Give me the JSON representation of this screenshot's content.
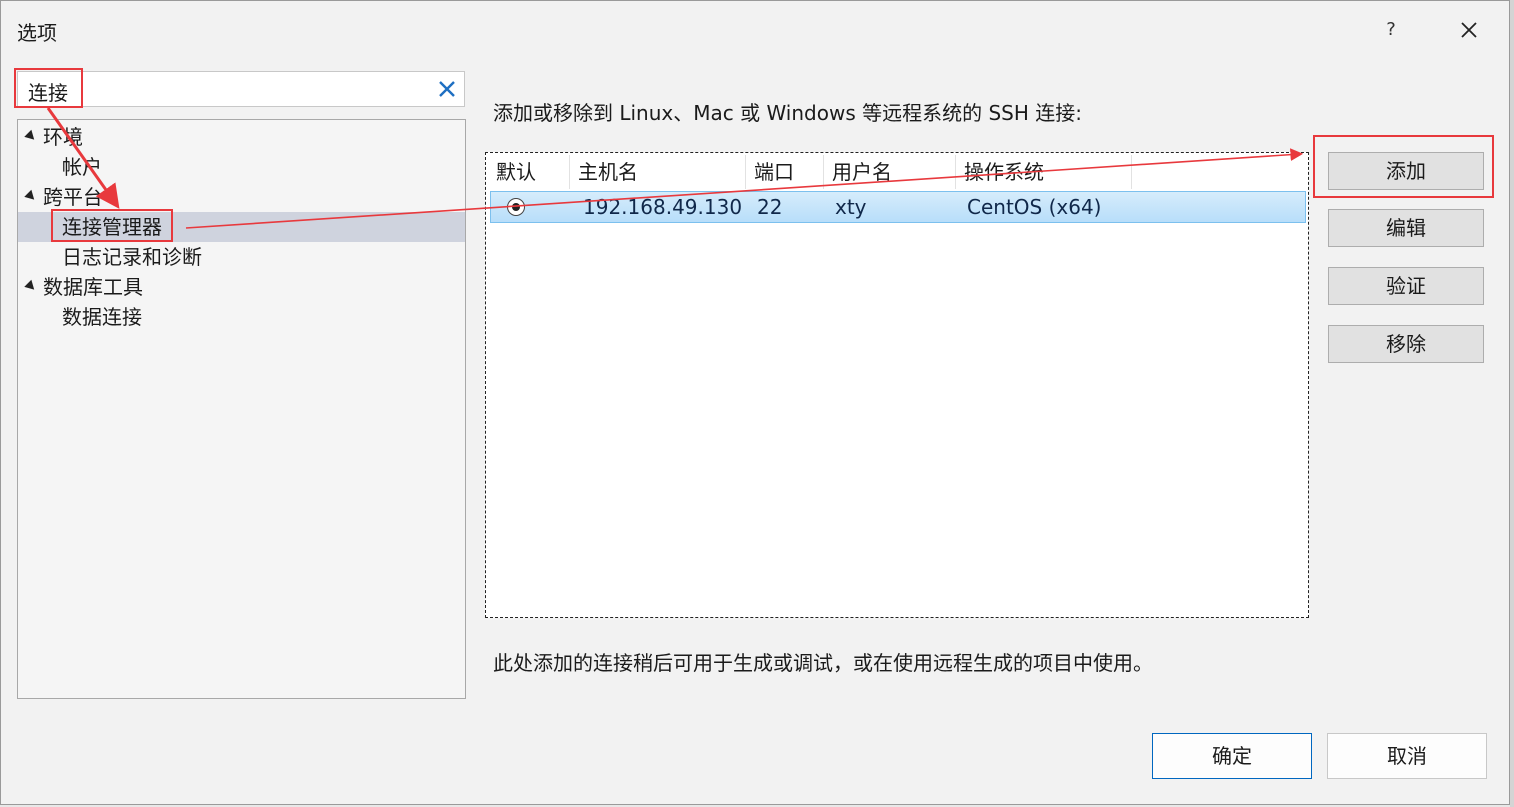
{
  "dialog": {
    "title": "选项",
    "help_label": "?"
  },
  "search": {
    "value": "连接"
  },
  "tree": {
    "items": [
      {
        "label": "环境"
      },
      {
        "label": "帐户"
      },
      {
        "label": "跨平台"
      },
      {
        "label": "连接管理器"
      },
      {
        "label": "日志记录和诊断"
      },
      {
        "label": "数据库工具"
      },
      {
        "label": "数据连接"
      }
    ],
    "selected": "连接管理器"
  },
  "main": {
    "description": "添加或移除到 Linux、Mac 或 Windows 等远程系统的 SSH 连接:",
    "columns": [
      "默认",
      "主机名",
      "端口",
      "用户名",
      "操作系统"
    ],
    "rows": [
      {
        "host": "192.168.49.130",
        "port": "22",
        "user": "xty",
        "os": "CentOS (x64)",
        "default": true
      }
    ],
    "note": "此处添加的连接稍后可用于生成或调试，或在使用远程生成的项目中使用。"
  },
  "buttons": {
    "add": "添加",
    "edit": "编辑",
    "verify": "验证",
    "remove": "移除",
    "ok": "确定",
    "cancel": "取消"
  },
  "annotation_color": "#e8393d",
  "accent_color": "#0067c0"
}
